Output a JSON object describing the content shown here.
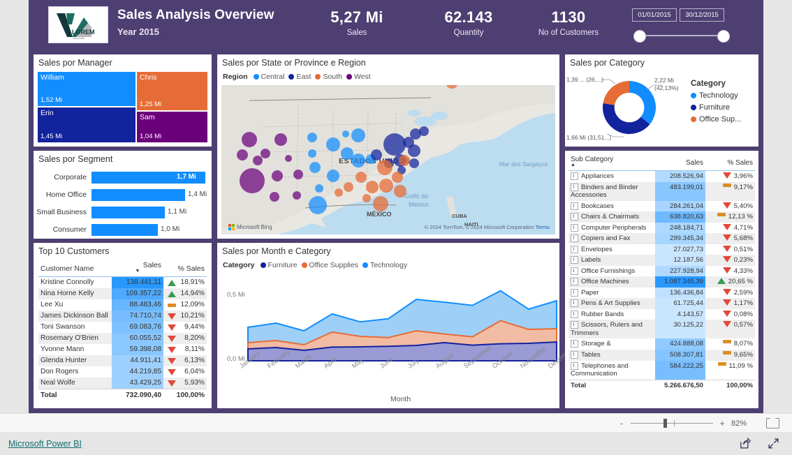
{
  "header": {
    "title": "Sales Analysis Overview",
    "subtitle": "Year 2015",
    "logo_text": "LOREM",
    "logo_sub": "corporate",
    "kpis": [
      {
        "name": "sales",
        "value": "5,27 Mi",
        "label": "Sales"
      },
      {
        "name": "quantity",
        "value": "62.143",
        "label": "Quantity"
      },
      {
        "name": "customers",
        "value": "1130",
        "label": "No of Customers"
      }
    ],
    "date_slicer": {
      "from": "01/01/2015",
      "to": "30/12/2015"
    }
  },
  "manager": {
    "title": "Sales por Manager",
    "tiles": [
      {
        "name": "William",
        "value": "1,52 Mi",
        "color": "#118DFF"
      },
      {
        "name": "Chris",
        "value": "1,25 Mi",
        "color": "#E66C37"
      },
      {
        "name": "Erin",
        "value": "1,45 Mi",
        "color": "#12239E"
      },
      {
        "name": "Sam",
        "value": "1,04 Mi",
        "color": "#6B007B"
      }
    ]
  },
  "segment": {
    "title": "Sales por Segment",
    "bar_color": "#118DFF",
    "rows": [
      {
        "label": "Corporate",
        "value": "1,7 Mi",
        "pct": 100
      },
      {
        "label": "Home Office",
        "value": "1,4 Mi",
        "pct": 82
      },
      {
        "label": "Small Business",
        "value": "1,1 Mi",
        "pct": 64
      },
      {
        "label": "Consumer",
        "value": "1,0 Mi",
        "pct": 58
      }
    ]
  },
  "top10": {
    "title": "Top 10 Customers",
    "columns": [
      "Customer Name",
      "Sales",
      "% Sales"
    ],
    "sort_column": "Sales",
    "rows": [
      {
        "name": "Kristine Connolly",
        "sales": "138.441,11",
        "pct": "18,91%",
        "trend": "up",
        "bar": 100
      },
      {
        "name": "Nina Horne Kelly",
        "sales": "109.357,22",
        "pct": "14,94%",
        "trend": "up",
        "bar": 79
      },
      {
        "name": "Lee Xu",
        "sales": "88.483,46",
        "pct": "12,09%",
        "trend": "flat",
        "bar": 64
      },
      {
        "name": "James Dickinson Ball",
        "sales": "74.710,74",
        "pct": "10,21%",
        "trend": "down",
        "bar": 54
      },
      {
        "name": "Toni Swanson",
        "sales": "69.083,76",
        "pct": "9,44%",
        "trend": "down",
        "bar": 50
      },
      {
        "name": "Rosemary O'Brien",
        "sales": "60.055,52",
        "pct": "8,20%",
        "trend": "down",
        "bar": 43
      },
      {
        "name": "Yvonne Mann",
        "sales": "59.398,08",
        "pct": "8,11%",
        "trend": "down",
        "bar": 43
      },
      {
        "name": "Glenda Hunter",
        "sales": "44.911,41",
        "pct": "6,13%",
        "trend": "down",
        "bar": 32
      },
      {
        "name": "Don Rogers",
        "sales": "44.219,85",
        "pct": "6,04%",
        "trend": "down",
        "bar": 32
      },
      {
        "name": "Neal Wolfe",
        "sales": "43.429,25",
        "pct": "5,93%",
        "trend": "down",
        "bar": 31
      }
    ],
    "total": {
      "label": "Total",
      "sales": "732.090,40",
      "pct": "100,00%"
    }
  },
  "map": {
    "title": "Sales por State or Province e Region",
    "legend_title": "Region",
    "legend": [
      {
        "label": "Central",
        "color": "#118DFF"
      },
      {
        "label": "East",
        "color": "#12239E"
      },
      {
        "label": "South",
        "color": "#E66C37"
      },
      {
        "label": "West",
        "color": "#6B007B"
      }
    ],
    "country_label": "ESTADOS UNIDOS",
    "place_labels": [
      "MÉXICO",
      "CUBA",
      "HAITI",
      "Golfo do México",
      "Mar dos Sargaços"
    ],
    "attribution_brand": "Microsoft Bing",
    "attribution": "© 2024 TomTom, © 2024 Microsoft Corporation",
    "attribution_terms": "Terms"
  },
  "line": {
    "title": "Sales por Month e Category",
    "legend_title": "Category",
    "legend": [
      {
        "label": "Furniture",
        "color": "#12239E"
      },
      {
        "label": "Office Supplies",
        "color": "#E66C37"
      },
      {
        "label": "Technology",
        "color": "#118DFF"
      }
    ]
  },
  "donut": {
    "title": "Sales por Category",
    "legend_title": "Category",
    "callouts": [
      {
        "text_line1": "2,22 Mi",
        "text_line2": "(42,13%)"
      },
      {
        "text_line1": "1,66 Mi (31,51...)",
        "text_line2": ""
      },
      {
        "text_line1": "1,39 ... (26,...)",
        "text_line2": ""
      }
    ],
    "legend": [
      {
        "label": "Technology",
        "color": "#118DFF"
      },
      {
        "label": "Furniture",
        "color": "#12239E"
      },
      {
        "label": "Office Sup...",
        "color": "#E66C37"
      }
    ]
  },
  "subcategory": {
    "columns": [
      "Sub Category",
      "Sales",
      "% Sales"
    ],
    "rows": [
      {
        "name": "Appliances",
        "sales": "208.526,94",
        "pct": "3,96%",
        "trend": "down",
        "bar": 19
      },
      {
        "name": "Binders and Binder Accessories",
        "sales": "483.199,01",
        "pct": "9,17%",
        "trend": "flat",
        "bar": 44
      },
      {
        "name": "Bookcases",
        "sales": "284.261,04",
        "pct": "5,40%",
        "trend": "down",
        "bar": 26
      },
      {
        "name": "Chairs & Chairmats",
        "sales": "638.820,63",
        "pct": "12,13 %",
        "trend": "flat",
        "bar": 59
      },
      {
        "name": "Computer Peripherals",
        "sales": "248.184,71",
        "pct": "4,71%",
        "trend": "down",
        "bar": 23
      },
      {
        "name": "Copiers and Fax",
        "sales": "299.345,34",
        "pct": "5,68%",
        "trend": "down",
        "bar": 27
      },
      {
        "name": "Envelopes",
        "sales": "27.027,73",
        "pct": "0,51%",
        "trend": "down",
        "bar": 3
      },
      {
        "name": "Labels",
        "sales": "12.187,56",
        "pct": "0,23%",
        "trend": "down",
        "bar": 1
      },
      {
        "name": "Office Furnishings",
        "sales": "227.928,94",
        "pct": "4,33%",
        "trend": "down",
        "bar": 21
      },
      {
        "name": "Office Machines",
        "sales": "1.087.345,39",
        "pct": "20,65 %",
        "trend": "up",
        "bar": 100
      },
      {
        "name": "Paper",
        "sales": "136.436,84",
        "pct": "2,59%",
        "trend": "down",
        "bar": 12
      },
      {
        "name": "Pens & Art Supplies",
        "sales": "61.725,44",
        "pct": "1,17%",
        "trend": "down",
        "bar": 6
      },
      {
        "name": "Rubber Bands",
        "sales": "4.143,57",
        "pct": "0,08%",
        "trend": "down",
        "bar": 1
      },
      {
        "name": "Scissors, Rulers and Trimmers",
        "sales": "30.125,22",
        "pct": "0,57%",
        "trend": "down",
        "bar": 3
      },
      {
        "name": "Storage &",
        "sales": "424.888,08",
        "pct": "8,07%",
        "trend": "flat",
        "bar": 39
      },
      {
        "name": "Tables",
        "sales": "508.307,81",
        "pct": "9,65%",
        "trend": "flat",
        "bar": 47
      },
      {
        "name": "Telephones and Communication",
        "sales": "584.222,25",
        "pct": "11,09 %",
        "trend": "flat",
        "bar": 54
      }
    ],
    "total": {
      "label": "Total",
      "sales": "5.266.676,50",
      "pct": "100,00%"
    }
  },
  "statusbar": {
    "zoom_out": "-",
    "zoom_in": "+",
    "zoom_level": "82%"
  },
  "footer": {
    "brand_link": "Microsoft Power BI"
  },
  "chart_data": [
    {
      "type": "treemap",
      "title": "Sales por Manager",
      "categories": [
        "William",
        "Chris",
        "Erin",
        "Sam"
      ],
      "values": [
        1.52,
        1.25,
        1.45,
        1.04
      ],
      "unit": "Mi",
      "colors": [
        "#118DFF",
        "#E66C37",
        "#12239E",
        "#6B007B"
      ]
    },
    {
      "type": "bar",
      "title": "Sales por Segment",
      "categories": [
        "Corporate",
        "Home Office",
        "Small Business",
        "Consumer"
      ],
      "values": [
        1.7,
        1.4,
        1.1,
        1.0
      ],
      "unit": "Mi",
      "xlabel": "",
      "ylabel": "",
      "orientation": "horizontal"
    },
    {
      "type": "pie",
      "title": "Sales por Category",
      "labels": [
        "Technology",
        "Furniture",
        "Office Supplies"
      ],
      "values": [
        2.22,
        1.66,
        1.39
      ],
      "percents": [
        42.13,
        31.51,
        26.36
      ],
      "colors": [
        "#118DFF",
        "#12239E",
        "#E66C37"
      ],
      "legend_position": "right",
      "donut": true
    },
    {
      "type": "area",
      "title": "Sales por Month e Category",
      "xlabel": "Month",
      "ylabel": "",
      "ylim": [
        0,
        0.6
      ],
      "ytick_labels": [
        "0,0 Mi",
        "0,5 Mi"
      ],
      "categories": [
        "January",
        "February",
        "March",
        "April",
        "May",
        "June",
        "July",
        "August",
        "September",
        "October",
        "November",
        "December"
      ],
      "stacked": true,
      "series": [
        {
          "name": "Furniture",
          "color": "#12239E",
          "values": [
            0.085,
            0.095,
            0.075,
            0.098,
            0.1,
            0.104,
            0.11,
            0.13,
            0.112,
            0.122,
            0.125,
            0.135
          ]
        },
        {
          "name": "Office Supplies",
          "color": "#E66C37",
          "values": [
            0.045,
            0.05,
            0.04,
            0.108,
            0.075,
            0.062,
            0.105,
            0.062,
            0.06,
            0.165,
            0.1,
            0.095
          ]
        },
        {
          "name": "Technology",
          "color": "#118DFF",
          "values": [
            0.11,
            0.125,
            0.1,
            0.13,
            0.104,
            0.135,
            0.225,
            0.228,
            0.225,
            0.215,
            0.145,
            0.2
          ]
        }
      ]
    },
    {
      "type": "table",
      "title": "Top 10 Customers",
      "columns": [
        "Customer Name",
        "Sales",
        "% Sales"
      ],
      "rows": [
        [
          "Kristine Connolly",
          138441.11,
          18.91
        ],
        [
          "Nina Horne Kelly",
          109357.22,
          14.94
        ],
        [
          "Lee Xu",
          88483.46,
          12.09
        ],
        [
          "James Dickinson Ball",
          74710.74,
          10.21
        ],
        [
          "Toni Swanson",
          69083.76,
          9.44
        ],
        [
          "Rosemary O'Brien",
          60055.52,
          8.2
        ],
        [
          "Yvonne Mann",
          59398.08,
          8.11
        ],
        [
          "Glenda Hunter",
          44911.41,
          6.13
        ],
        [
          "Don Rogers",
          44219.85,
          6.04
        ],
        [
          "Neal Wolfe",
          43429.25,
          5.93
        ]
      ],
      "total": [
        "Total",
        732090.4,
        100.0
      ]
    },
    {
      "type": "table",
      "title": "Sub Category",
      "columns": [
        "Sub Category",
        "Sales",
        "% Sales"
      ],
      "rows": [
        [
          "Appliances",
          208526.94,
          3.96
        ],
        [
          "Binders and Binder Accessories",
          483199.01,
          9.17
        ],
        [
          "Bookcases",
          284261.04,
          5.4
        ],
        [
          "Chairs & Chairmats",
          638820.63,
          12.13
        ],
        [
          "Computer Peripherals",
          248184.71,
          4.71
        ],
        [
          "Copiers and Fax",
          299345.34,
          5.68
        ],
        [
          "Envelopes",
          27027.73,
          0.51
        ],
        [
          "Labels",
          12187.56,
          0.23
        ],
        [
          "Office Furnishings",
          227928.94,
          4.33
        ],
        [
          "Office Machines",
          1087345.39,
          20.65
        ],
        [
          "Paper",
          136436.84,
          2.59
        ],
        [
          "Pens & Art Supplies",
          61725.44,
          1.17
        ],
        [
          "Rubber Bands",
          4143.57,
          0.08
        ],
        [
          "Scissors, Rulers and Trimmers",
          30125.22,
          0.57
        ],
        [
          "Storage &",
          424888.08,
          8.07
        ],
        [
          "Tables",
          508307.81,
          9.65
        ],
        [
          "Telephones and Communication",
          584222.25,
          11.09
        ]
      ],
      "total": [
        "Total",
        5266676.5,
        100.0
      ]
    },
    {
      "type": "scatter",
      "title": "Sales por State or Province e Region",
      "legend": [
        "Central",
        "East",
        "South",
        "West"
      ],
      "colors": [
        "#118DFF",
        "#12239E",
        "#E66C37",
        "#6B007B"
      ],
      "map": true
    }
  ]
}
